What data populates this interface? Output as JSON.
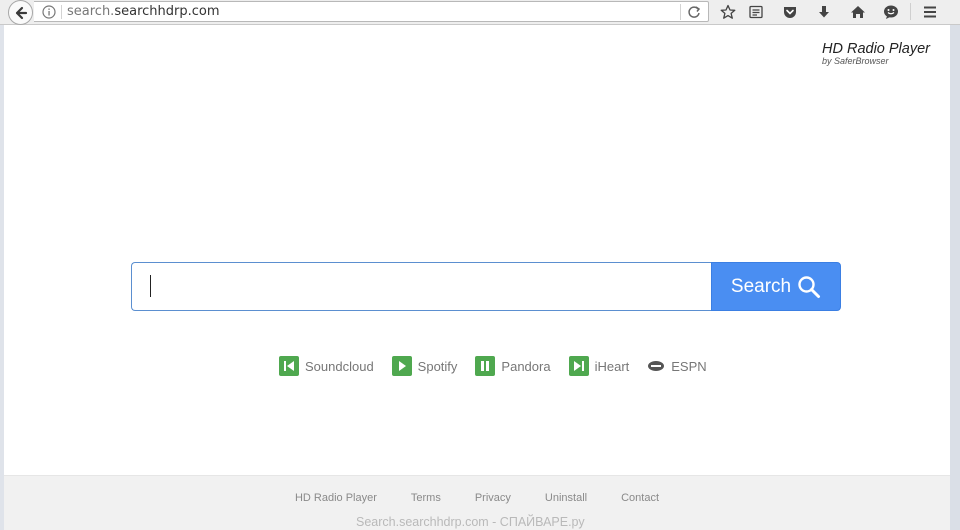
{
  "browser": {
    "url_prefix": "search.",
    "url_host": "searchhdrp.com"
  },
  "brand": {
    "title": "HD Radio Player",
    "subtitle": "by SaferBrowser"
  },
  "search": {
    "placeholder": "",
    "value": "",
    "button_label": "Search"
  },
  "quick_links": [
    {
      "label": "Soundcloud",
      "icon": "skip-back-icon"
    },
    {
      "label": "Spotify",
      "icon": "play-icon"
    },
    {
      "label": "Pandora",
      "icon": "pause-icon"
    },
    {
      "label": "iHeart",
      "icon": "skip-forward-icon"
    },
    {
      "label": "ESPN",
      "icon": "eye-icon"
    }
  ],
  "footer": {
    "links": [
      "HD Radio Player",
      "Terms",
      "Privacy",
      "Uninstall",
      "Contact"
    ],
    "watermark": "Search.searchhdrp.com - СПАЙВАРЕ.ру"
  },
  "colors": {
    "accent": "#4a8ef2",
    "quick_link_icon": "#4fa84f"
  }
}
